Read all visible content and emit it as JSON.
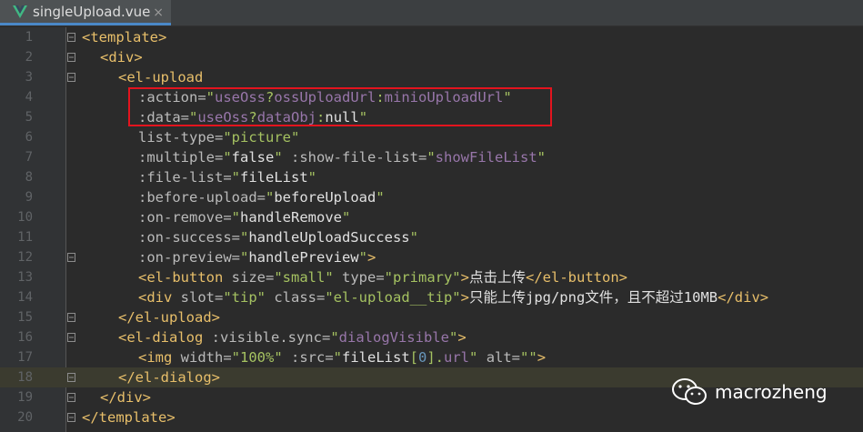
{
  "tab": {
    "title": "singleUpload.vue",
    "close": "×"
  },
  "lines": [
    {
      "n": "1",
      "tokens": [
        {
          "c": "t",
          "v": "<template>"
        }
      ]
    },
    {
      "n": "2",
      "tokens": [
        {
          "c": "t",
          "v": "<div>"
        }
      ]
    },
    {
      "n": "3",
      "tokens": [
        {
          "c": "t",
          "v": "<el-upload"
        }
      ]
    },
    {
      "n": "4",
      "tokens": [
        {
          "c": "a",
          "v": ":action="
        },
        {
          "c": "s",
          "v": "\""
        },
        {
          "c": "p",
          "v": "useOss"
        },
        {
          "c": "s",
          "v": "?"
        },
        {
          "c": "p",
          "v": "ossUploadUrl"
        },
        {
          "c": "s",
          "v": ":"
        },
        {
          "c": "p",
          "v": "minioUploadUrl"
        },
        {
          "c": "s",
          "v": "\""
        }
      ]
    },
    {
      "n": "5",
      "tokens": [
        {
          "c": "a",
          "v": ":data="
        },
        {
          "c": "s",
          "v": "\""
        },
        {
          "c": "p",
          "v": "useOss"
        },
        {
          "c": "s",
          "v": "?"
        },
        {
          "c": "p",
          "v": "dataObj"
        },
        {
          "c": "s",
          "v": ":"
        },
        {
          "c": "w",
          "v": "null"
        },
        {
          "c": "s",
          "v": "\""
        }
      ]
    },
    {
      "n": "6",
      "tokens": [
        {
          "c": "a",
          "v": "list-type="
        },
        {
          "c": "s",
          "v": "\"picture\""
        }
      ]
    },
    {
      "n": "7",
      "tokens": [
        {
          "c": "a",
          "v": ":multiple="
        },
        {
          "c": "s",
          "v": "\""
        },
        {
          "c": "w",
          "v": "false"
        },
        {
          "c": "s",
          "v": "\""
        },
        {
          "c": "a",
          "v": " :show-file-list="
        },
        {
          "c": "s",
          "v": "\""
        },
        {
          "c": "p",
          "v": "showFileList"
        },
        {
          "c": "s",
          "v": "\""
        }
      ]
    },
    {
      "n": "8",
      "tokens": [
        {
          "c": "a",
          "v": ":file-list="
        },
        {
          "c": "s",
          "v": "\""
        },
        {
          "c": "w",
          "v": "fileList"
        },
        {
          "c": "s",
          "v": "\""
        }
      ]
    },
    {
      "n": "9",
      "tokens": [
        {
          "c": "a",
          "v": ":before-upload="
        },
        {
          "c": "s",
          "v": "\""
        },
        {
          "c": "w",
          "v": "beforeUpload"
        },
        {
          "c": "s",
          "v": "\""
        }
      ]
    },
    {
      "n": "10",
      "tokens": [
        {
          "c": "a",
          "v": ":on-remove="
        },
        {
          "c": "s",
          "v": "\""
        },
        {
          "c": "w",
          "v": "handleRemove"
        },
        {
          "c": "s",
          "v": "\""
        }
      ]
    },
    {
      "n": "11",
      "tokens": [
        {
          "c": "a",
          "v": ":on-success="
        },
        {
          "c": "s",
          "v": "\""
        },
        {
          "c": "w",
          "v": "handleUploadSuccess"
        },
        {
          "c": "s",
          "v": "\""
        }
      ]
    },
    {
      "n": "12",
      "tokens": [
        {
          "c": "a",
          "v": ":on-preview="
        },
        {
          "c": "s",
          "v": "\""
        },
        {
          "c": "w",
          "v": "handlePreview"
        },
        {
          "c": "s",
          "v": "\""
        },
        {
          "c": "t",
          "v": ">"
        }
      ]
    },
    {
      "n": "13",
      "tokens": [
        {
          "c": "t",
          "v": "<el-button"
        },
        {
          "c": "a",
          "v": " size="
        },
        {
          "c": "s",
          "v": "\"small\""
        },
        {
          "c": "a",
          "v": " type="
        },
        {
          "c": "s",
          "v": "\"primary\""
        },
        {
          "c": "t",
          "v": ">"
        },
        {
          "c": "w",
          "v": "点击上传"
        },
        {
          "c": "t",
          "v": "</el-button>"
        }
      ]
    },
    {
      "n": "14",
      "tokens": [
        {
          "c": "t",
          "v": "<div"
        },
        {
          "c": "a",
          "v": " slot="
        },
        {
          "c": "s",
          "v": "\"tip\""
        },
        {
          "c": "a",
          "v": " class="
        },
        {
          "c": "s",
          "v": "\"el-upload__tip\""
        },
        {
          "c": "t",
          "v": ">"
        },
        {
          "c": "w",
          "v": "只能上传jpg/png文件，且不超过10MB"
        },
        {
          "c": "t",
          "v": "</div>"
        }
      ]
    },
    {
      "n": "15",
      "tokens": [
        {
          "c": "t",
          "v": "</el-upload>"
        }
      ]
    },
    {
      "n": "16",
      "tokens": [
        {
          "c": "t",
          "v": "<el-dialog"
        },
        {
          "c": "a",
          "v": " :visible.sync="
        },
        {
          "c": "s",
          "v": "\""
        },
        {
          "c": "p",
          "v": "dialogVisible"
        },
        {
          "c": "s",
          "v": "\""
        },
        {
          "c": "t",
          "v": ">"
        }
      ]
    },
    {
      "n": "17",
      "tokens": [
        {
          "c": "t",
          "v": "<img"
        },
        {
          "c": "a",
          "v": " width="
        },
        {
          "c": "s",
          "v": "\"100%\""
        },
        {
          "c": "a",
          "v": " :src="
        },
        {
          "c": "s",
          "v": "\""
        },
        {
          "c": "w",
          "v": "fileList"
        },
        {
          "c": "s",
          "v": "["
        },
        {
          "c": "n",
          "v": "0"
        },
        {
          "c": "s",
          "v": "]."
        },
        {
          "c": "p",
          "v": "url"
        },
        {
          "c": "s",
          "v": "\""
        },
        {
          "c": "a",
          "v": " alt="
        },
        {
          "c": "s",
          "v": "\"\""
        },
        {
          "c": "t",
          "v": ">"
        }
      ]
    },
    {
      "n": "18",
      "tokens": [
        {
          "c": "t",
          "v": "</el-dialog>"
        }
      ]
    },
    {
      "n": "19",
      "tokens": [
        {
          "c": "t",
          "v": "</div>"
        }
      ]
    },
    {
      "n": "20",
      "tokens": [
        {
          "c": "t",
          "v": "</template>"
        }
      ]
    }
  ],
  "watermark": {
    "text": "macrozheng"
  }
}
